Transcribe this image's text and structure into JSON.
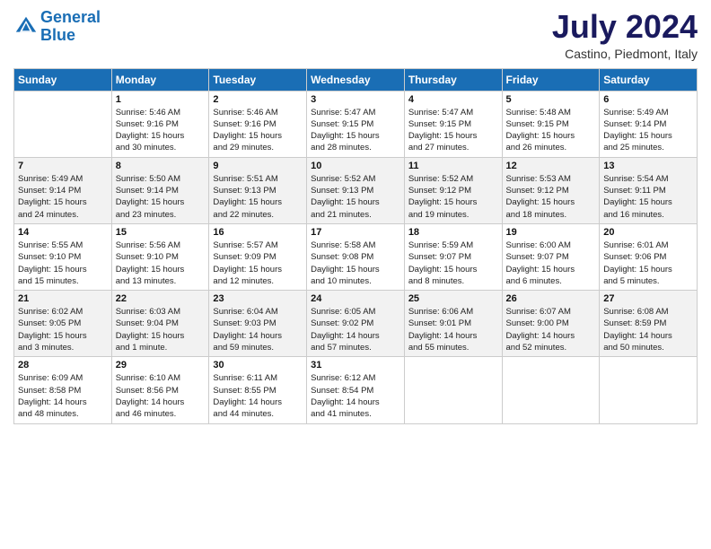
{
  "header": {
    "logo_line1": "General",
    "logo_line2": "Blue",
    "month": "July 2024",
    "location": "Castino, Piedmont, Italy"
  },
  "weekdays": [
    "Sunday",
    "Monday",
    "Tuesday",
    "Wednesday",
    "Thursday",
    "Friday",
    "Saturday"
  ],
  "weeks": [
    [
      {
        "day": "",
        "info": ""
      },
      {
        "day": "1",
        "info": "Sunrise: 5:46 AM\nSunset: 9:16 PM\nDaylight: 15 hours\nand 30 minutes."
      },
      {
        "day": "2",
        "info": "Sunrise: 5:46 AM\nSunset: 9:16 PM\nDaylight: 15 hours\nand 29 minutes."
      },
      {
        "day": "3",
        "info": "Sunrise: 5:47 AM\nSunset: 9:15 PM\nDaylight: 15 hours\nand 28 minutes."
      },
      {
        "day": "4",
        "info": "Sunrise: 5:47 AM\nSunset: 9:15 PM\nDaylight: 15 hours\nand 27 minutes."
      },
      {
        "day": "5",
        "info": "Sunrise: 5:48 AM\nSunset: 9:15 PM\nDaylight: 15 hours\nand 26 minutes."
      },
      {
        "day": "6",
        "info": "Sunrise: 5:49 AM\nSunset: 9:14 PM\nDaylight: 15 hours\nand 25 minutes."
      }
    ],
    [
      {
        "day": "7",
        "info": "Sunrise: 5:49 AM\nSunset: 9:14 PM\nDaylight: 15 hours\nand 24 minutes."
      },
      {
        "day": "8",
        "info": "Sunrise: 5:50 AM\nSunset: 9:14 PM\nDaylight: 15 hours\nand 23 minutes."
      },
      {
        "day": "9",
        "info": "Sunrise: 5:51 AM\nSunset: 9:13 PM\nDaylight: 15 hours\nand 22 minutes."
      },
      {
        "day": "10",
        "info": "Sunrise: 5:52 AM\nSunset: 9:13 PM\nDaylight: 15 hours\nand 21 minutes."
      },
      {
        "day": "11",
        "info": "Sunrise: 5:52 AM\nSunset: 9:12 PM\nDaylight: 15 hours\nand 19 minutes."
      },
      {
        "day": "12",
        "info": "Sunrise: 5:53 AM\nSunset: 9:12 PM\nDaylight: 15 hours\nand 18 minutes."
      },
      {
        "day": "13",
        "info": "Sunrise: 5:54 AM\nSunset: 9:11 PM\nDaylight: 15 hours\nand 16 minutes."
      }
    ],
    [
      {
        "day": "14",
        "info": "Sunrise: 5:55 AM\nSunset: 9:10 PM\nDaylight: 15 hours\nand 15 minutes."
      },
      {
        "day": "15",
        "info": "Sunrise: 5:56 AM\nSunset: 9:10 PM\nDaylight: 15 hours\nand 13 minutes."
      },
      {
        "day": "16",
        "info": "Sunrise: 5:57 AM\nSunset: 9:09 PM\nDaylight: 15 hours\nand 12 minutes."
      },
      {
        "day": "17",
        "info": "Sunrise: 5:58 AM\nSunset: 9:08 PM\nDaylight: 15 hours\nand 10 minutes."
      },
      {
        "day": "18",
        "info": "Sunrise: 5:59 AM\nSunset: 9:07 PM\nDaylight: 15 hours\nand 8 minutes."
      },
      {
        "day": "19",
        "info": "Sunrise: 6:00 AM\nSunset: 9:07 PM\nDaylight: 15 hours\nand 6 minutes."
      },
      {
        "day": "20",
        "info": "Sunrise: 6:01 AM\nSunset: 9:06 PM\nDaylight: 15 hours\nand 5 minutes."
      }
    ],
    [
      {
        "day": "21",
        "info": "Sunrise: 6:02 AM\nSunset: 9:05 PM\nDaylight: 15 hours\nand 3 minutes."
      },
      {
        "day": "22",
        "info": "Sunrise: 6:03 AM\nSunset: 9:04 PM\nDaylight: 15 hours\nand 1 minute."
      },
      {
        "day": "23",
        "info": "Sunrise: 6:04 AM\nSunset: 9:03 PM\nDaylight: 14 hours\nand 59 minutes."
      },
      {
        "day": "24",
        "info": "Sunrise: 6:05 AM\nSunset: 9:02 PM\nDaylight: 14 hours\nand 57 minutes."
      },
      {
        "day": "25",
        "info": "Sunrise: 6:06 AM\nSunset: 9:01 PM\nDaylight: 14 hours\nand 55 minutes."
      },
      {
        "day": "26",
        "info": "Sunrise: 6:07 AM\nSunset: 9:00 PM\nDaylight: 14 hours\nand 52 minutes."
      },
      {
        "day": "27",
        "info": "Sunrise: 6:08 AM\nSunset: 8:59 PM\nDaylight: 14 hours\nand 50 minutes."
      }
    ],
    [
      {
        "day": "28",
        "info": "Sunrise: 6:09 AM\nSunset: 8:58 PM\nDaylight: 14 hours\nand 48 minutes."
      },
      {
        "day": "29",
        "info": "Sunrise: 6:10 AM\nSunset: 8:56 PM\nDaylight: 14 hours\nand 46 minutes."
      },
      {
        "day": "30",
        "info": "Sunrise: 6:11 AM\nSunset: 8:55 PM\nDaylight: 14 hours\nand 44 minutes."
      },
      {
        "day": "31",
        "info": "Sunrise: 6:12 AM\nSunset: 8:54 PM\nDaylight: 14 hours\nand 41 minutes."
      },
      {
        "day": "",
        "info": ""
      },
      {
        "day": "",
        "info": ""
      },
      {
        "day": "",
        "info": ""
      }
    ]
  ]
}
